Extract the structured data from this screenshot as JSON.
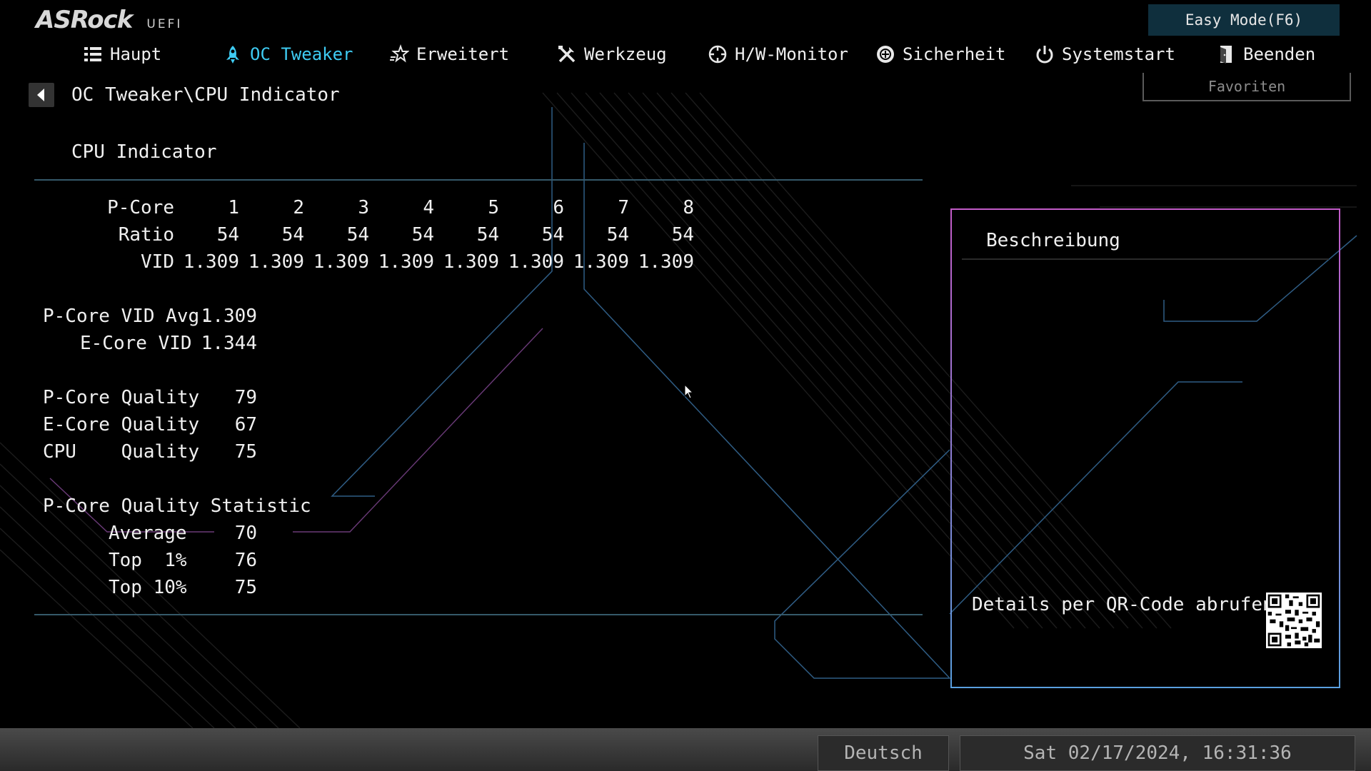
{
  "brand": {
    "logo": "ASRock",
    "sub": "UEFI"
  },
  "easy_mode_label": "Easy Mode(F6)",
  "nav": {
    "tabs": [
      {
        "label": "Haupt",
        "icon": "list-icon",
        "active": false
      },
      {
        "label": "OC Tweaker",
        "icon": "rocket-icon",
        "active": true
      },
      {
        "label": "Erweitert",
        "icon": "star-icon",
        "active": false
      },
      {
        "label": "Werkzeug",
        "icon": "tools-icon",
        "active": false
      },
      {
        "label": "H/W-Monitor",
        "icon": "crosshair-icon",
        "active": false
      },
      {
        "label": "Sicherheit",
        "icon": "shield-icon",
        "active": false
      },
      {
        "label": "Systemstart",
        "icon": "power-icon",
        "active": false
      },
      {
        "label": "Beenden",
        "icon": "exit-door-icon",
        "active": false
      }
    ]
  },
  "breadcrumb": "OC Tweaker\\CPU Indicator",
  "favorites_label": "Favoriten",
  "panel": {
    "title": "CPU Indicator",
    "pcore_table": {
      "header_label": "P-Core",
      "cores": [
        "1",
        "2",
        "3",
        "4",
        "5",
        "6",
        "7",
        "8"
      ],
      "rows": [
        {
          "label": "Ratio",
          "values": [
            "54",
            "54",
            "54",
            "54",
            "54",
            "54",
            "54",
            "54"
          ]
        },
        {
          "label": "VID",
          "values": [
            "1.309",
            "1.309",
            "1.309",
            "1.309",
            "1.309",
            "1.309",
            "1.309",
            "1.309"
          ]
        }
      ]
    },
    "vid": [
      {
        "label": "P-Core VID Avg.",
        "value": "1.309"
      },
      {
        "label": "E-Core VID",
        "value": "1.344"
      }
    ],
    "quality": [
      {
        "label": "P-Core Quality",
        "value": "79"
      },
      {
        "label": "E-Core Quality",
        "value": "67"
      },
      {
        "label": "CPU    Quality",
        "value": "75"
      }
    ],
    "statistic_title": "P-Core Quality Statistic",
    "statistic": [
      {
        "label": "Average",
        "value": "70"
      },
      {
        "label": "Top  1%",
        "value": "76"
      },
      {
        "label": "Top 10%",
        "value": "75"
      }
    ]
  },
  "description": {
    "title": "Beschreibung",
    "qr_label": "Details per QR-Code abrufen"
  },
  "footer": {
    "language": "Deutsch",
    "datetime": "Sat 02/17/2024, 16:31:36"
  },
  "colors": {
    "accent": "#3ecbf2",
    "easy_mode_bg": "#0f2f3d",
    "border_pink": "#c35bc8",
    "border_blue": "#5aa0e0"
  }
}
